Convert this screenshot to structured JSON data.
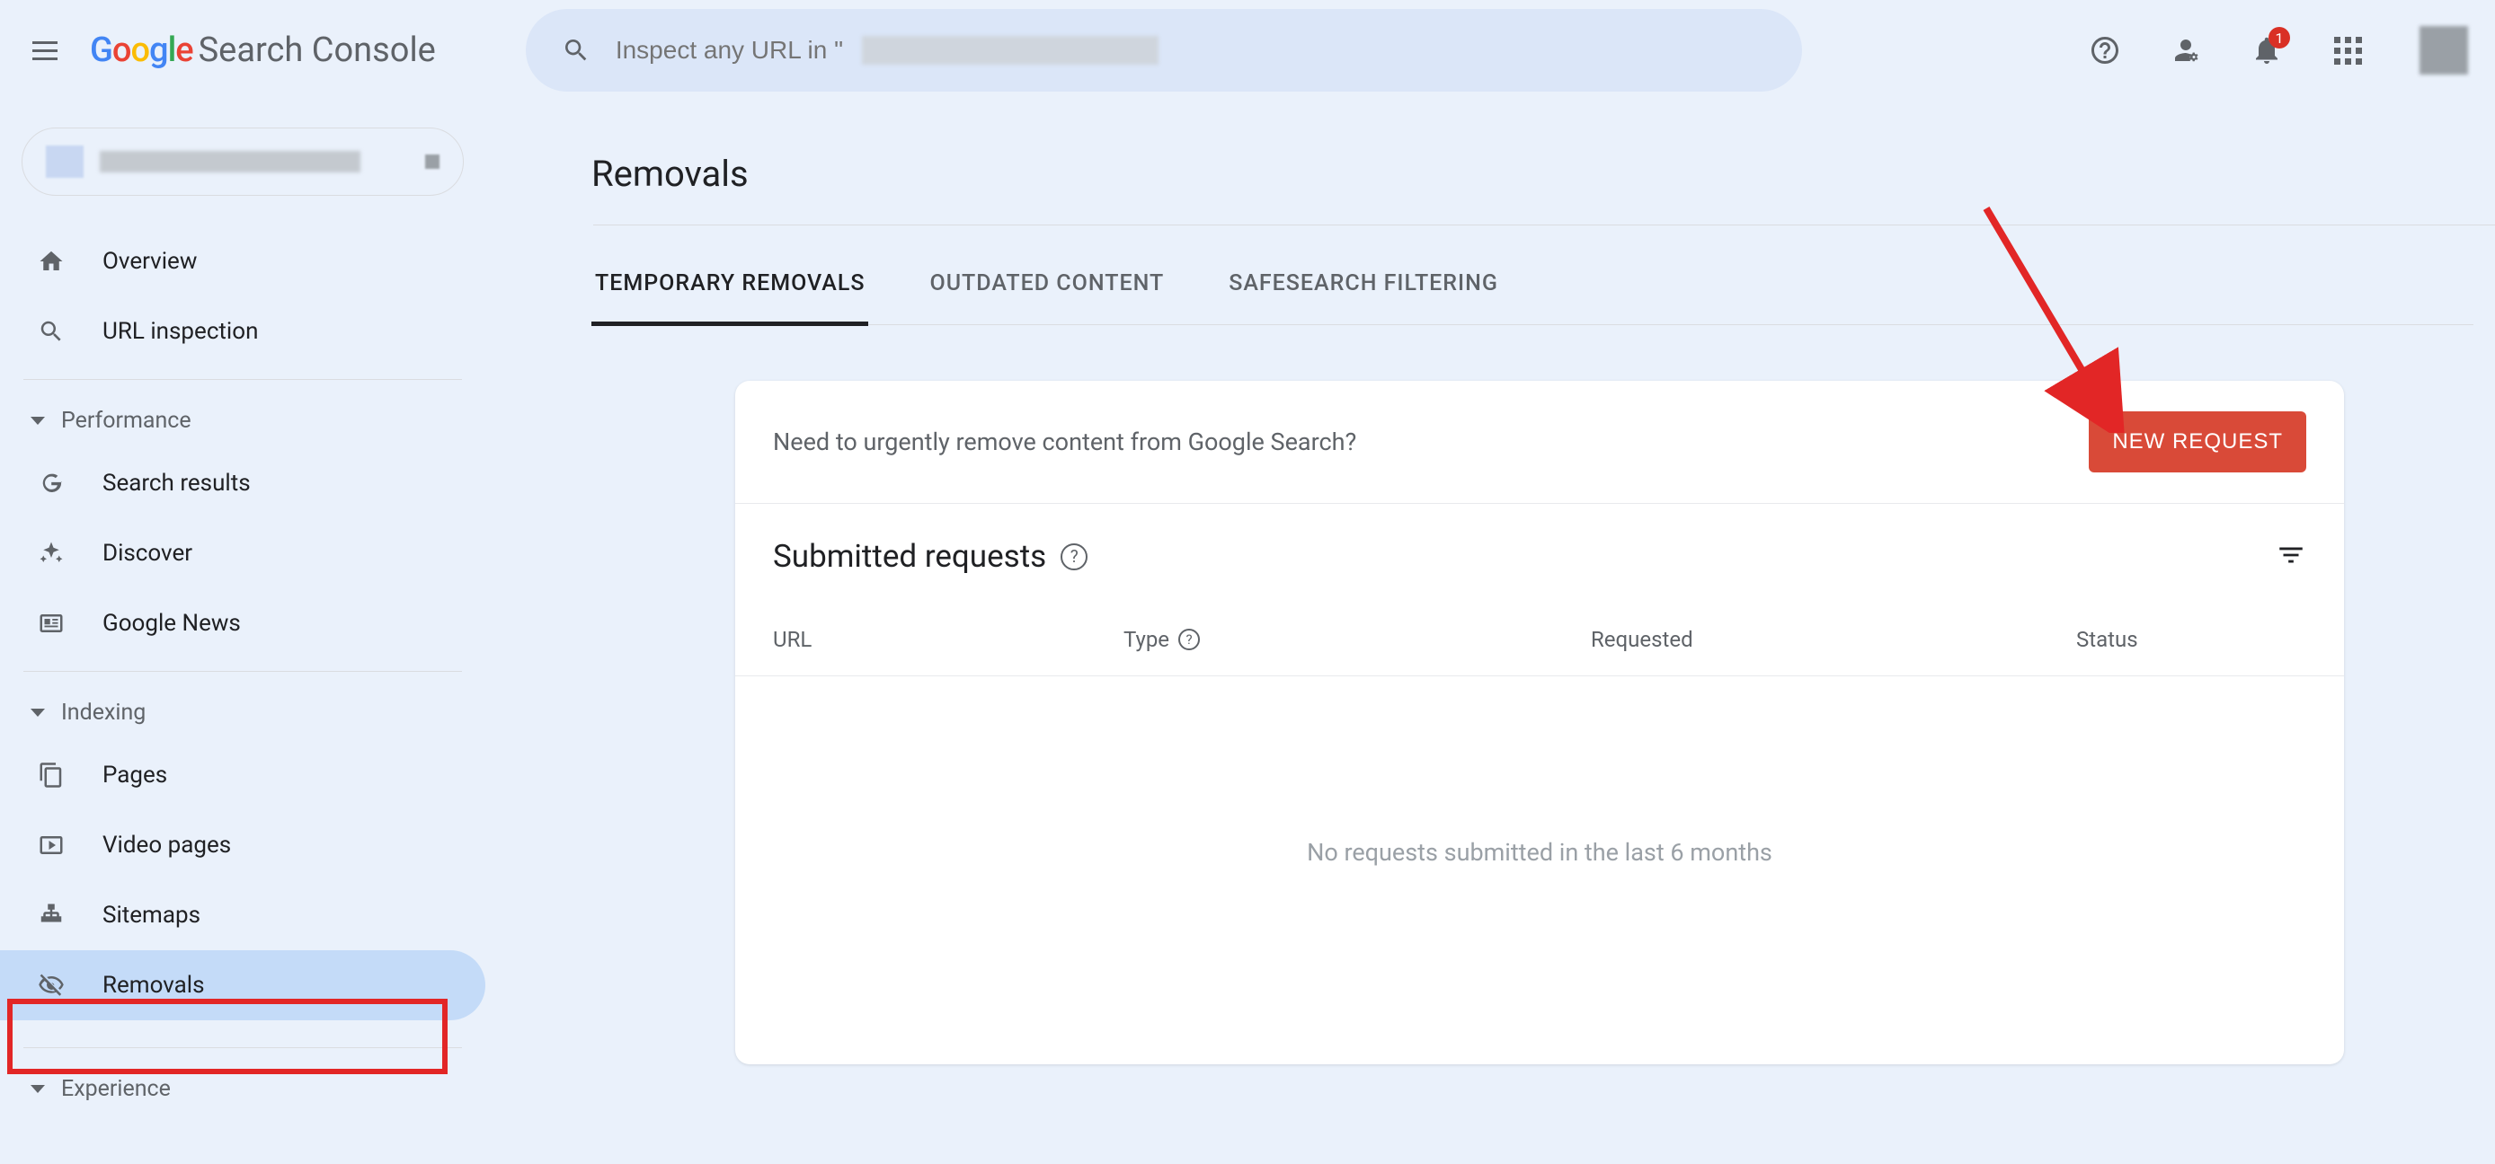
{
  "product_name_google": "Google",
  "product_name_sc": "Search Console",
  "search_placeholder": "Inspect any URL in \"",
  "notification_count": "1",
  "sidebar": {
    "overview": "Overview",
    "url_inspection": "URL inspection",
    "section_performance": "Performance",
    "search_results": "Search results",
    "discover": "Discover",
    "google_news": "Google News",
    "section_indexing": "Indexing",
    "pages": "Pages",
    "video_pages": "Video pages",
    "sitemaps": "Sitemaps",
    "removals": "Removals",
    "section_experience": "Experience"
  },
  "page_title": "Removals",
  "tabs": {
    "temporary": "Temporary Removals",
    "outdated": "Outdated Content",
    "safesearch": "Safesearch Filtering"
  },
  "card": {
    "prompt": "Need to urgently remove content from Google Search?",
    "new_request": "NEW REQUEST",
    "submitted_title": "Submitted requests",
    "col_url": "URL",
    "col_type": "Type",
    "col_requested": "Requested",
    "col_status": "Status",
    "empty": "No requests submitted in the last 6 months"
  }
}
